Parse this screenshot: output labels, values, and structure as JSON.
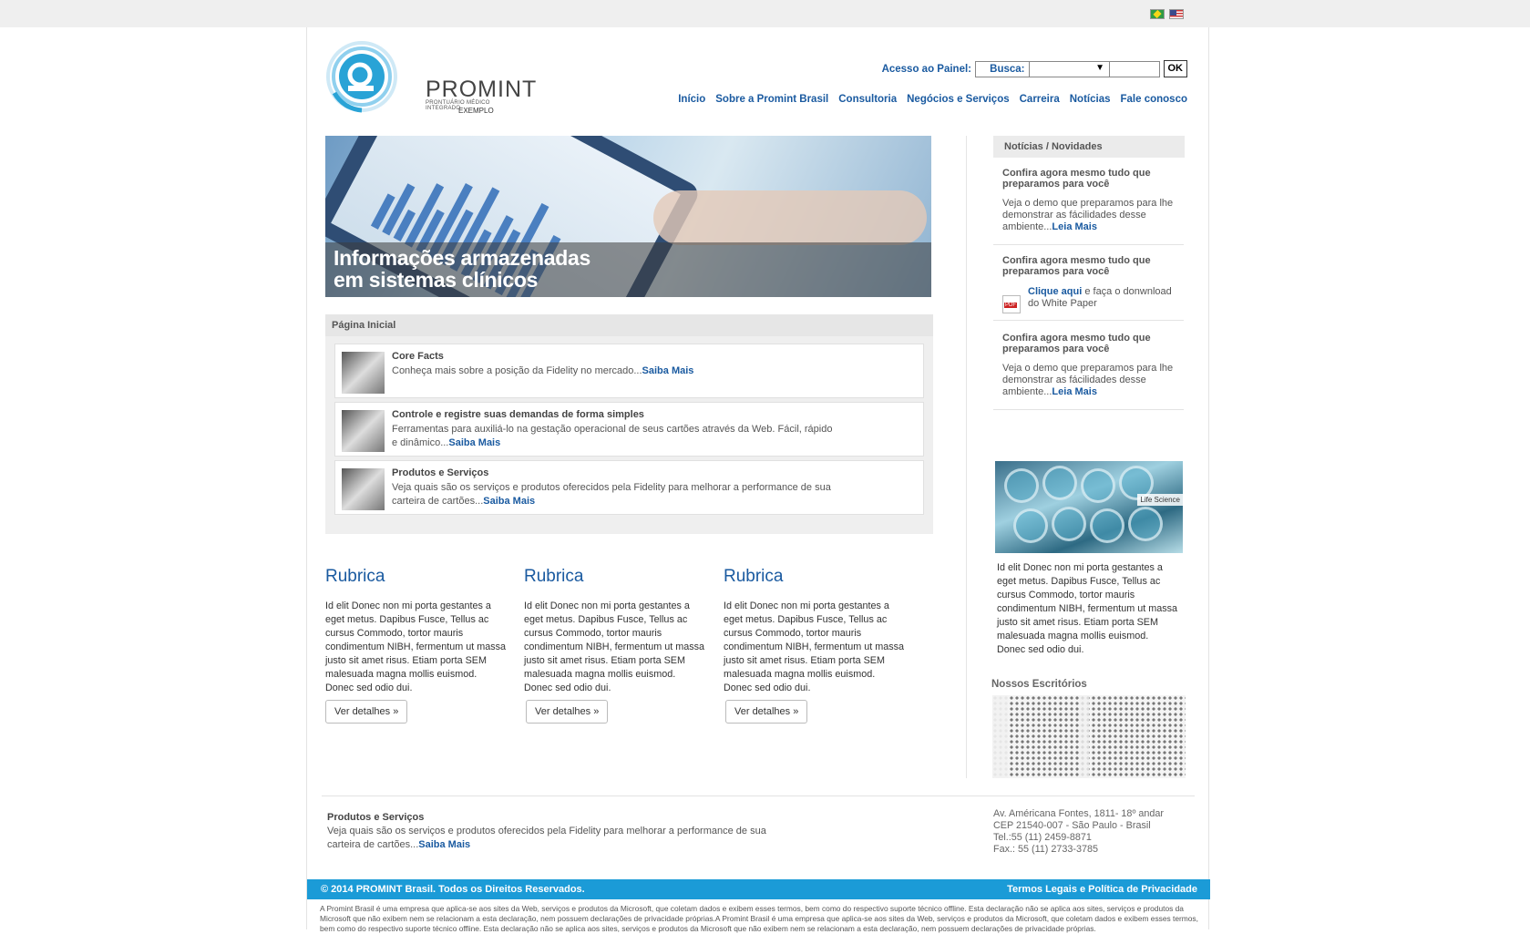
{
  "header": {
    "logo_name": "PROMINT",
    "logo_sub": "PRONTUÁRIO MÉDICO INTEGRADO",
    "logo_example": "EXEMPLO",
    "access_label": "Acesso ao Painel:",
    "access_value": "",
    "search_label": "Busca:",
    "search_value": "",
    "ok_label": "OK",
    "nav": [
      "Início",
      "Sobre a Promint Brasil",
      "Consultoria",
      "Negócios e Serviços",
      "Carreira",
      "Notícias",
      "Fale conosco"
    ]
  },
  "hero": {
    "line1": "Informações armazenadas",
    "line2": "em sistemas clínicos"
  },
  "panel": {
    "title": "Página Inicial",
    "items": [
      {
        "title": "Core Facts",
        "desc": "Conheça mais sobre a posição da Fidelity no mercado...",
        "more": "Saiba Mais"
      },
      {
        "title": "Controle e registre suas demandas de forma simples",
        "desc": "Ferramentas para auxiliá-lo na gestação operacional de seus cartões através da Web. Fácil, rápido e dinâmico...",
        "more": "Saiba Mais"
      },
      {
        "title": "Produtos e Serviços",
        "desc": "Veja quais são os serviços e produtos oferecidos pela Fidelity para melhorar a performance de sua carteira de cartões...",
        "more": "Saiba Mais"
      }
    ]
  },
  "columns": [
    {
      "title": "Rubrica",
      "text": "Id elit Donec non mi porta gestantes a eget metus. Dapibus Fusce, Tellus ac cursus Commodo, tortor mauris condimentum NIBH, fermentum ut massa justo sit amet risus. Etiam porta SEM malesuada magna mollis euismod. Donec sed odio dui.",
      "button": "Ver detalhes »"
    },
    {
      "title": "Rubrica",
      "text": "Id elit Donec non mi porta gestantes a eget metus. Dapibus Fusce, Tellus ac cursus Commodo, tortor mauris condimentum NIBH, fermentum ut massa justo sit amet risus. Etiam porta SEM malesuada magna mollis euismod. Donec sed odio dui.",
      "button": "Ver detalhes »"
    },
    {
      "title": "Rubrica",
      "text": "Id elit Donec non mi porta gestantes a eget metus. Dapibus Fusce, Tellus ac cursus Commodo, tortor mauris condimentum NIBH, fermentum ut massa justo sit amet risus. Etiam porta SEM malesuada magna mollis euismod. Donec sed odio dui.",
      "button": "Ver detalhes »"
    }
  ],
  "sidebar": {
    "title": "Notícias / Novidades",
    "news": [
      {
        "title": "Confira agora mesmo tudo que preparamos para você",
        "desc": "Veja o demo que preparamos para lhe demonstrar as fácilidades desse ambiente...",
        "more": "Leia Mais"
      },
      {
        "title": "Confira agora mesmo tudo que preparamos para você",
        "link": "Clique aqui",
        "desc": " e faça o donwnload do White Paper"
      },
      {
        "title": "Confira agora mesmo tudo que preparamos para você",
        "desc": "Veja o demo que preparamos para lhe demonstrar as fácilidades desse ambiente...",
        "more": "Leia Mais"
      }
    ],
    "image_tag": "Life Science",
    "image_text": "Id elit Donec non mi porta gestantes a eget metus. Dapibus Fusce, Tellus ac cursus Commodo, tortor mauris condimentum NIBH, fermentum ut massa justo sit amet risus. Etiam porta SEM malesuada magna mollis euismod. Donec sed odio dui.",
    "offices_title": "Nossos Escritórios"
  },
  "footer": {
    "prod_title": "Produtos e Serviços",
    "prod_desc": "Veja quais são os serviços e produtos oferecidos pela Fidelity para melhorar a performance de sua carteira de cartões...",
    "prod_more": "Saiba Mais",
    "address": [
      "Av. Américana Fontes, 1811- 18º andar",
      "CEP 21540-007 - São Paulo - Brasil",
      "Tel.:55 (11) 2459-8871",
      "Fax.: 55 (11) 2733-3785"
    ],
    "copyright": "© 2014 PROMINT Brasil. Todos os Direitos Reservados.",
    "legal_link": "Termos Legais e Política de Privacidade",
    "legal_text": "A Promint Brasil é uma empresa que aplica-se aos sites da Web, serviços e produtos da Microsoft, que coletam dados e exibem esses termos, bem como do respectivo suporte técnico offline. Esta declaração não se aplica aos sites, serviços e produtos da Microsoft que não exibem nem se relacionam a esta declaração, nem possuem declarações de privacidade próprias.A Promint Brasil é uma empresa que aplica-se aos sites da Web, serviços e produtos da Microsoft, que coletam dados e exibem esses termos, bem como do respectivo suporte técnico offline. Esta declaração não se aplica aos sites, serviços e produtos da Microsoft que não exibem nem se relacionam a esta declaração, nem possuem declarações de privacidade próprias."
  },
  "colors": {
    "link": "#1a5aa0",
    "footer_bar": "#1b9bd7",
    "logo": "#29a3d6"
  }
}
